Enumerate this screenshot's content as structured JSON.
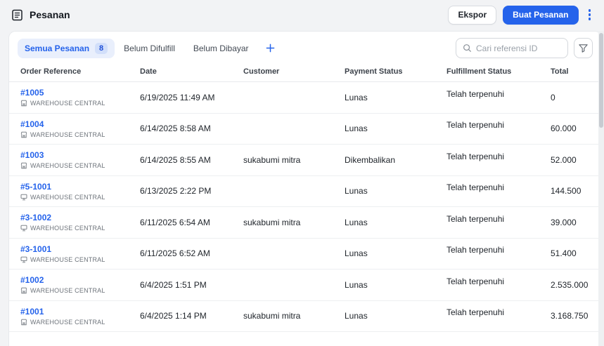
{
  "header": {
    "title": "Pesanan",
    "buttons": {
      "export": "Ekspor",
      "create": "Buat Pesanan"
    }
  },
  "tabs": {
    "items": [
      {
        "label": "Semua Pesanan",
        "badge": "8",
        "active": true
      },
      {
        "label": "Belum Difulfill",
        "active": false
      },
      {
        "label": "Belum Dibayar",
        "active": false
      }
    ]
  },
  "search": {
    "placeholder": "Cari referensi ID"
  },
  "icons": {
    "title": "orders-icon",
    "menu": "kebab-menu-icon",
    "add_view": "plus-icon",
    "search": "search-icon",
    "filter": "filter-icon",
    "store": "store-icon",
    "pos": "pos-terminal-icon"
  },
  "colors": {
    "accent": "#2563eb",
    "active_tab_bg": "#e9effc",
    "badge_bg": "#d2dffa",
    "link": "#2563eb"
  },
  "table": {
    "columns": {
      "ref": "Order Reference",
      "date": "Date",
      "customer": "Customer",
      "payment": "Payment Status",
      "fulfillment": "Fulfillment Status",
      "total": "Total"
    },
    "rows": [
      {
        "ref": "#1005",
        "location": "WAREHOUSE CENTRAL",
        "icon": "store",
        "date": "6/19/2025 11:49 AM",
        "customer": "",
        "payment": "Lunas",
        "fulfillment": "Telah terpenuhi",
        "total": "0"
      },
      {
        "ref": "#1004",
        "location": "WAREHOUSE CENTRAL",
        "icon": "store",
        "date": "6/14/2025 8:58 AM",
        "customer": "",
        "payment": "Lunas",
        "fulfillment": "Telah terpenuhi",
        "total": "60.000"
      },
      {
        "ref": "#1003",
        "location": "WAREHOUSE CENTRAL",
        "icon": "store",
        "date": "6/14/2025 8:55 AM",
        "customer": "sukabumi mitra",
        "payment": "Dikembalikan",
        "fulfillment": "Telah terpenuhi",
        "total": "52.000"
      },
      {
        "ref": "#5-1001",
        "location": "WAREHOUSE CENTRAL",
        "icon": "pos",
        "date": "6/13/2025 2:22 PM",
        "customer": "",
        "payment": "Lunas",
        "fulfillment": "Telah terpenuhi",
        "total": "144.500"
      },
      {
        "ref": "#3-1002",
        "location": "WAREHOUSE CENTRAL",
        "icon": "pos",
        "date": "6/11/2025 6:54 AM",
        "customer": "sukabumi mitra",
        "payment": "Lunas",
        "fulfillment": "Telah terpenuhi",
        "total": "39.000"
      },
      {
        "ref": "#3-1001",
        "location": "WAREHOUSE CENTRAL",
        "icon": "pos",
        "date": "6/11/2025 6:52 AM",
        "customer": "",
        "payment": "Lunas",
        "fulfillment": "Telah terpenuhi",
        "total": "51.400"
      },
      {
        "ref": "#1002",
        "location": "WAREHOUSE CENTRAL",
        "icon": "store",
        "date": "6/4/2025 1:51 PM",
        "customer": "",
        "payment": "Lunas",
        "fulfillment": "Telah terpenuhi",
        "total": "2.535.000"
      },
      {
        "ref": "#1001",
        "location": "WAREHOUSE CENTRAL",
        "icon": "store",
        "date": "6/4/2025 1:14 PM",
        "customer": "sukabumi mitra",
        "payment": "Lunas",
        "fulfillment": "Telah terpenuhi",
        "total": "3.168.750"
      }
    ]
  }
}
